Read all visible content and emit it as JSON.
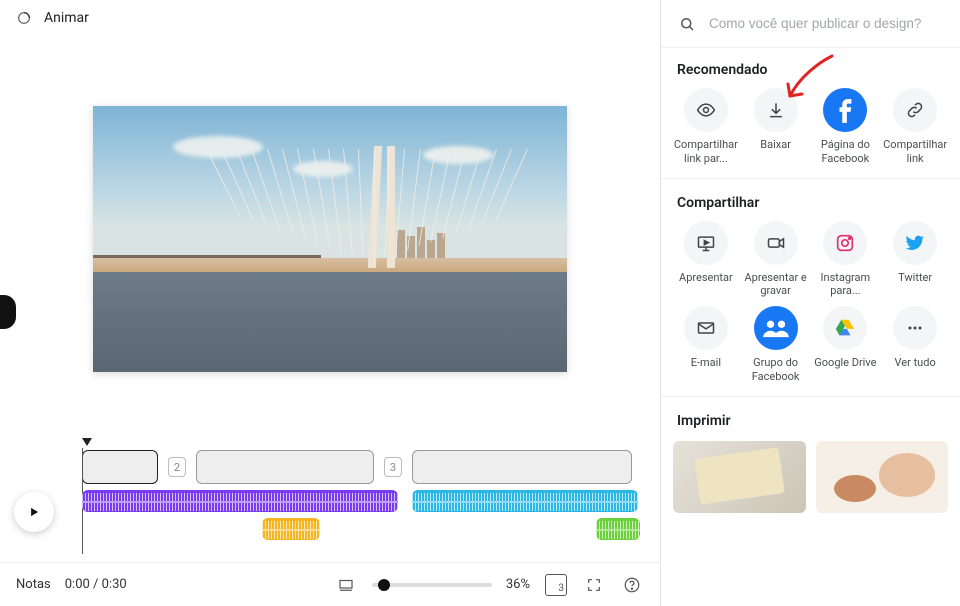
{
  "topbar": {
    "animar_label": "Animar"
  },
  "search": {
    "placeholder": "Como você quer publicar o design?"
  },
  "sections": {
    "recommended": "Recomendado",
    "share": "Compartilhar",
    "print": "Imprimir"
  },
  "recommended": [
    {
      "label": "Compartilhar link par...",
      "icon": "eye"
    },
    {
      "label": "Baixar",
      "icon": "download"
    },
    {
      "label": "Página do Facebook",
      "icon": "facebook"
    },
    {
      "label": "Compartilhar link",
      "icon": "link"
    }
  ],
  "share": [
    {
      "label": "Apresentar",
      "icon": "present"
    },
    {
      "label": "Apresentar e gravar",
      "icon": "record"
    },
    {
      "label": "Instagram para...",
      "icon": "instagram"
    },
    {
      "label": "Twitter",
      "icon": "twitter"
    },
    {
      "label": "E-mail",
      "icon": "mail"
    },
    {
      "label": "Grupo do Facebook",
      "icon": "fbgroup"
    },
    {
      "label": "Google Drive",
      "icon": "gdrive"
    },
    {
      "label": "Ver tudo",
      "icon": "more"
    }
  ],
  "timeline": {
    "counts": {
      "clip2": "2",
      "clip3": "3"
    }
  },
  "bottombar": {
    "notas": "Notas",
    "time": "0:00 / 0:30",
    "zoom": "36%",
    "page_count": "3"
  },
  "colors": {
    "facebook": "#1877f2",
    "instagram": "#e1306c",
    "twitter": "#1da1f2",
    "fbgroup": "#1877f2",
    "gdrive_y": "#ffc107",
    "gdrive_g": "#34a853",
    "gdrive_b": "#4285f4"
  }
}
